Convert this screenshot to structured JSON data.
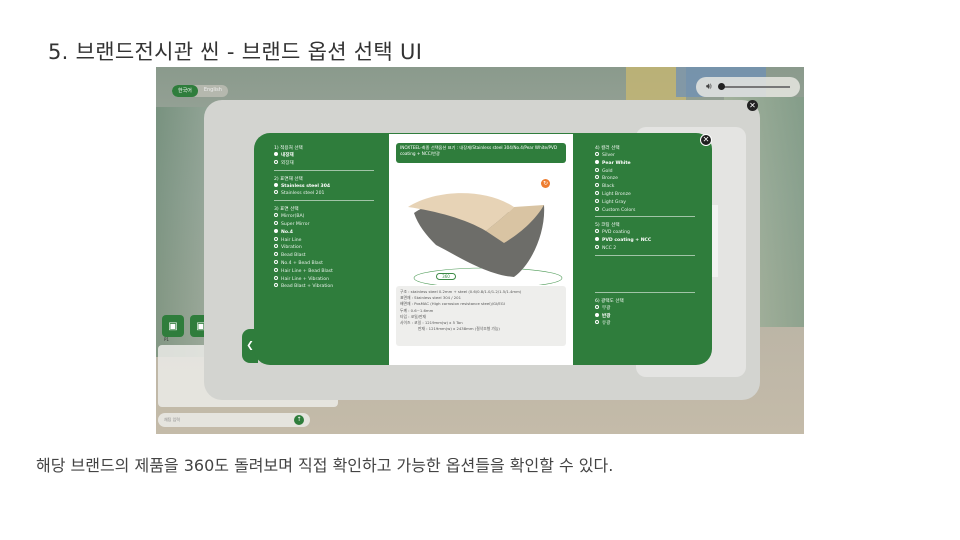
{
  "slide": {
    "title": "5. 브랜드전시관 씬 - 브랜드 옵션 선택 UI",
    "caption": "해당 브랜드의 제품을 360도 돌려보며 직접 확인하고 가능한 옵션들을 확인할 수 있다."
  },
  "app": {
    "language": {
      "korean": "한국어",
      "english": "English",
      "selected": "한국어"
    },
    "side_buttons": {
      "label": "P1"
    },
    "chat_input": {
      "placeholder": "채팅 입력"
    }
  },
  "summary": "INOXTEEL-최종 선택옵션 표기 : 내장재/Stainless steel 304/No.4/Pear White/PVD coating + NCC/반광",
  "left_column": {
    "groups": [
      {
        "title": "1) 적용처 선택",
        "options": [
          {
            "label": "내장재",
            "selected": true
          },
          {
            "label": "외장재",
            "selected": false
          }
        ]
      },
      {
        "title": "2) 표면재 선택",
        "options": [
          {
            "label": "Stainless steel 304",
            "selected": true
          },
          {
            "label": "Stainless steel 201",
            "selected": false
          }
        ]
      },
      {
        "title": "3) 표면 선택",
        "options": [
          {
            "label": "Mirror(BA)",
            "selected": false
          },
          {
            "label": "Super Mirror",
            "selected": false
          },
          {
            "label": "No.4",
            "selected": true
          },
          {
            "label": "Hair Line",
            "selected": false
          },
          {
            "label": "Vibration",
            "selected": false
          },
          {
            "label": "Bead Blast",
            "selected": false
          },
          {
            "label": "No.4 + Bead Blast",
            "selected": false
          },
          {
            "label": "Hair Line + Bead Blast",
            "selected": false
          },
          {
            "label": "Hair Line + Vibration",
            "selected": false
          },
          {
            "label": "Bead Blast + Vibration",
            "selected": false
          }
        ]
      }
    ]
  },
  "right_column": {
    "groups": [
      {
        "title": "4) 컬러 선택",
        "options": [
          {
            "label": "Silver",
            "selected": false
          },
          {
            "label": "Pear White",
            "selected": true
          },
          {
            "label": "Gold",
            "selected": false
          },
          {
            "label": "Bronze",
            "selected": false
          },
          {
            "label": "Black",
            "selected": false
          },
          {
            "label": "Light Bronze",
            "selected": false
          },
          {
            "label": "Light Gray",
            "selected": false
          },
          {
            "label": "Custom Colors",
            "selected": false
          }
        ]
      },
      {
        "title": "5) 코팅 선택",
        "options": [
          {
            "label": "PVD coating",
            "selected": false
          },
          {
            "label": "PVD coating + NCC",
            "selected": true
          },
          {
            "label": "NCC 2",
            "selected": false
          }
        ]
      },
      {
        "title": "6) 광택도 선택",
        "options": [
          {
            "label": "무광",
            "selected": false
          },
          {
            "label": "반광",
            "selected": true
          },
          {
            "label": "유광",
            "selected": false
          }
        ]
      }
    ]
  },
  "product": {
    "rotate_label": "360"
  },
  "specs": [
    "구조 : stainless steel 0.2mm + steel (0.6/0.8/1.0/1.2/1.5/1.4mm)",
    "표면재 : Stainless steel 304 / 201",
    "배면재 : PosMAC (High corrosion resistance steel)/GI/EGI",
    "두께 : 0.6~1.6mm",
    "타입 : 코일/판재",
    "사이즈 : 코일 : 1219mm(w) x 5 Ton",
    "판재 : 1219mm(w) x 2438mm (절삭조형 가능)"
  ],
  "colors": {
    "brand_green": "#2f7d3c",
    "accent_orange": "#ee7d30"
  },
  "icons": [
    "volume-icon",
    "close-icon",
    "rotate-icon",
    "send-icon",
    "person-icon"
  ]
}
